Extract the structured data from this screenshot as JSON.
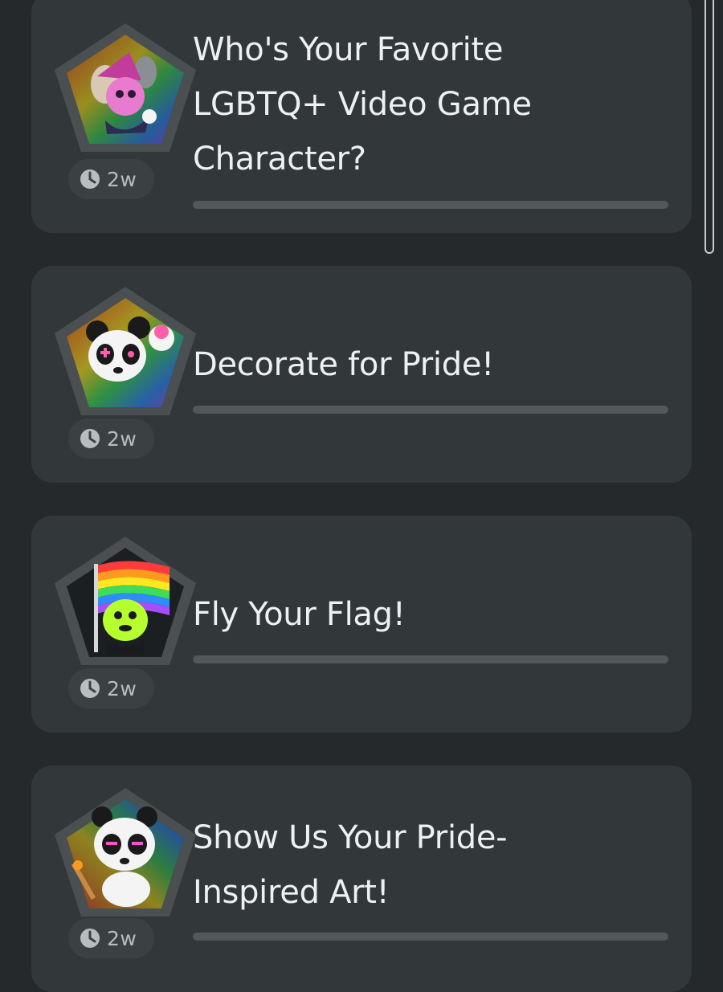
{
  "events": [
    {
      "title": "Who's Your Favorite LGBTQ+ Video Game Character?",
      "time_left": "2w",
      "badge_icon": "pride-characters-badge-icon",
      "progress": 0
    },
    {
      "title": "Decorate for Pride!",
      "time_left": "2w",
      "badge_icon": "pride-panda-badge-icon",
      "progress": 0
    },
    {
      "title": "Fly Your Flag!",
      "time_left": "2w",
      "badge_icon": "pride-flag-badge-icon",
      "progress": 0
    },
    {
      "title": "Show Us Your Pride-Inspired Art!",
      "time_left": "2w",
      "badge_icon": "pride-artist-panda-badge-icon",
      "progress": 0
    }
  ],
  "colors": {
    "background": "#25292b",
    "card": "#323739",
    "progress_track": "#53585b",
    "text": "#eef0f1",
    "muted_text": "#b8bdc0"
  }
}
